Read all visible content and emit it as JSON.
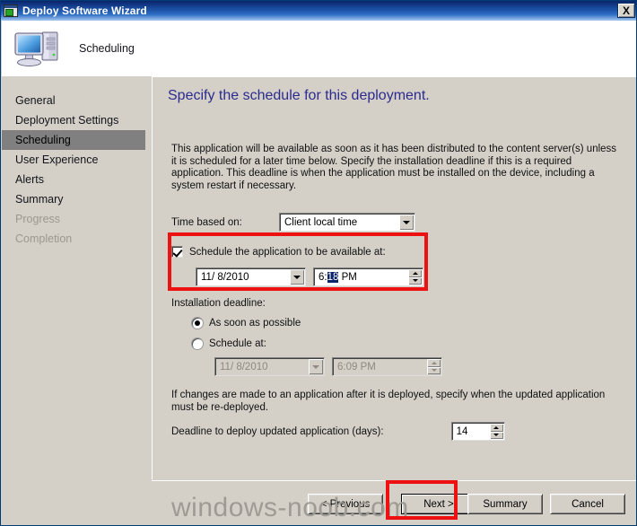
{
  "window": {
    "title": "Deploy Software Wizard",
    "close_label": "X",
    "header_title": "Scheduling"
  },
  "sidebar": {
    "items": [
      {
        "label": "General",
        "state": "normal"
      },
      {
        "label": "Deployment Settings",
        "state": "normal"
      },
      {
        "label": "Scheduling",
        "state": "selected"
      },
      {
        "label": "User Experience",
        "state": "normal"
      },
      {
        "label": "Alerts",
        "state": "normal"
      },
      {
        "label": "Summary",
        "state": "normal"
      },
      {
        "label": "Progress",
        "state": "disabled"
      },
      {
        "label": "Completion",
        "state": "disabled"
      }
    ]
  },
  "main": {
    "heading": "Specify the schedule for this deployment.",
    "intro": "This application will be available as soon as it has been distributed to the content server(s) unless it is scheduled for a later time below. Specify the installation deadline if this is a required application. This deadline is when the application must be installed on the device, including a system restart if necessary.",
    "time_based_on": {
      "label": "Time based on:",
      "value": "Client local time"
    },
    "schedule_available": {
      "checkbox_label": "Schedule the application to be available at:",
      "checked": true,
      "date_value": "11/  8/2010",
      "time_prefix": "6:",
      "time_selected": "18",
      "time_suffix": " PM"
    },
    "installation_deadline": {
      "label": "Installation deadline:",
      "option_asap": "As soon as possible",
      "option_schedule": "Schedule at:",
      "selected": "asap",
      "disabled_date_value": "11/  8/2010",
      "disabled_time_value": "6:09 PM"
    },
    "redeploy": {
      "note": "If changes are made to an application after it is deployed, specify when the updated application must be re-deployed.",
      "days_label": "Deadline to deploy updated application (days):",
      "days_value": "14"
    }
  },
  "footer": {
    "previous": "< Previous",
    "next": "Next >",
    "summary": "Summary",
    "cancel": "Cancel"
  },
  "watermark": "windows-noob.com",
  "colors": {
    "titlebar": "#0a246a",
    "dialog_face": "#d4d0c8",
    "heading": "#2b2b8f",
    "selection": "#0a246a",
    "annotation": "#ee1111",
    "nav_selected": "#808080"
  }
}
